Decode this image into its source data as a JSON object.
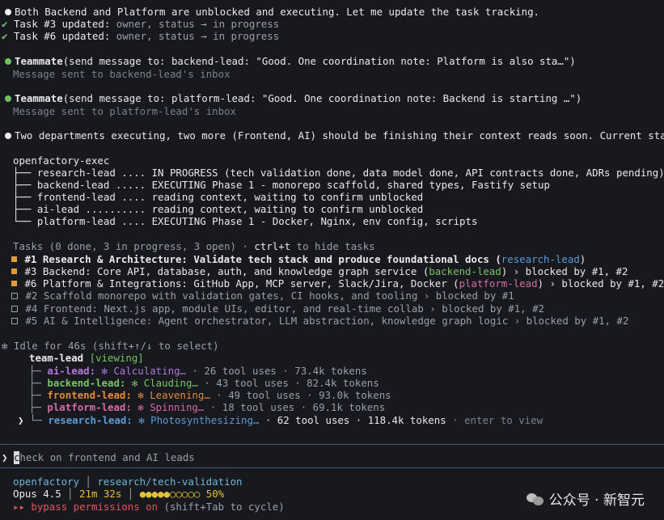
{
  "lines": {
    "l1": "Both Backend and Platform are unblocked and executing. Let me update the task tracking.",
    "t3_a": "Task #3 updated:",
    "t3_b": "owner, status → in progress",
    "t6_a": "Task #6 updated:",
    "t6_b": "owner, status → in progress",
    "tm1_a": "Teammate",
    "tm1_b": "(send message to: backend-lead: \"Good. One coordination note: Platform is also sta…\")",
    "tm1_res": "Message sent to backend-lead's inbox",
    "tm2_a": "Teammate",
    "tm2_b": "(send message to: platform-lead: \"Good. One coordination note: Backend is starting …\")",
    "tm2_res": "Message sent to platform-lead's inbox",
    "state": "Two departments executing, two more (Frontend, AI) should be finishing their context reads soon. Current state:"
  },
  "tree": {
    "root": "openfactory-exec",
    "items": [
      "├── research-lead .... IN PROGRESS (tech validation done, data model done, API contracts done, ADRs pending)",
      "├── backend-lead ..... EXECUTING Phase 1 - monorepo scaffold, shared types, Fastify setup",
      "├── frontend-lead .... reading context, waiting to confirm unblocked",
      "├── ai-lead .......... reading context, waiting to confirm unblocked",
      "└── platform-lead .... EXECUTING Phase 1 - Docker, Nginx, env config, scripts"
    ]
  },
  "tasks": {
    "header_a": "Tasks (0 done, 3 in progress, 3 open) · ",
    "header_b": "ctrl+t",
    "header_c": " to hide tasks",
    "t1_a": "#1 Research & Architecture: Validate tech stack and produce foundational docs (",
    "t1_owner": "research-lead",
    "t1_c": ")",
    "t3_a": "#3 Backend: Core API, database, auth, and knowledge graph service (",
    "t3_owner": "backend-lead",
    "t3_c": ") › blocked by #1, #2",
    "t6_a": "#6 Platform & Integrations: GitHub App, MCP server, Slack/Jira, Docker (",
    "t6_owner": "platform-lead",
    "t6_c": ") › blocked by #1, #2",
    "t2": "#2 Scaffold monorepo with validation gates, CI hooks, and tooling › blocked by #1",
    "t4": "#4 Frontend: Next.js app, module UIs, editor, and real-time collab › blocked by #1, #2",
    "t5": "#5 AI & Intelligence: Agent orchestrator, LLM abstraction, knowledge graph logic › blocked by #1, #2"
  },
  "team": {
    "idle": "✻ Idle for 46s (shift+↑/↓ to select)",
    "lead": "team-lead",
    "viewing": "[viewing]",
    "members": [
      {
        "prefix": "├─ ",
        "name": "ai-lead:",
        "status": "✻ Calculating…",
        "stats": " · 26 tool uses · 73.4k tokens",
        "hint": "",
        "color": "#b07ad8"
      },
      {
        "prefix": "├─ ",
        "name": "backend-lead:",
        "status": "✻ Clauding…",
        "stats": " · 43 tool uses · 82.4k tokens",
        "hint": "",
        "color": "#79c267"
      },
      {
        "prefix": "├─ ",
        "name": "frontend-lead:",
        "status": "✻ Leavening…",
        "stats": " · 49 tool uses · 93.0k tokens",
        "hint": "",
        "color": "#e48a3a"
      },
      {
        "prefix": "├─ ",
        "name": "platform-lead:",
        "status": "✻ Spinning…",
        "stats": " · 18 tool uses · 69.1k tokens",
        "hint": "",
        "color": "#d86aa5"
      },
      {
        "prefix": "└─ ",
        "name": "research-lead:",
        "status": "✻ Photosynthesizing…",
        "stats": " · 62 tool uses · 118.4k tokens",
        "hint": " · enter to view",
        "color": "#5b9bd8"
      }
    ]
  },
  "input": {
    "prompt": "❯",
    "cursor_char": "c",
    "text": "heck on frontend and AI leads"
  },
  "status": {
    "project": "openfactory",
    "branch": "research/tech-validation",
    "model": "Opus 4.5",
    "time": "21m 32s",
    "progress_dots": "●●●●●○○○○○",
    "progress_value": "50%",
    "bypass_arrow": "▸▸",
    "bypass": "bypass permissions on",
    "bypass_hint": " (shift+Tab to cycle)"
  },
  "watermark": "公众号 · 新智元",
  "colors": {
    "background": "#17191f",
    "green": "#79c267",
    "blue": "#5b9bd8",
    "orange": "#e48a3a",
    "pink": "#d86aa5",
    "purple": "#b07ad8"
  }
}
